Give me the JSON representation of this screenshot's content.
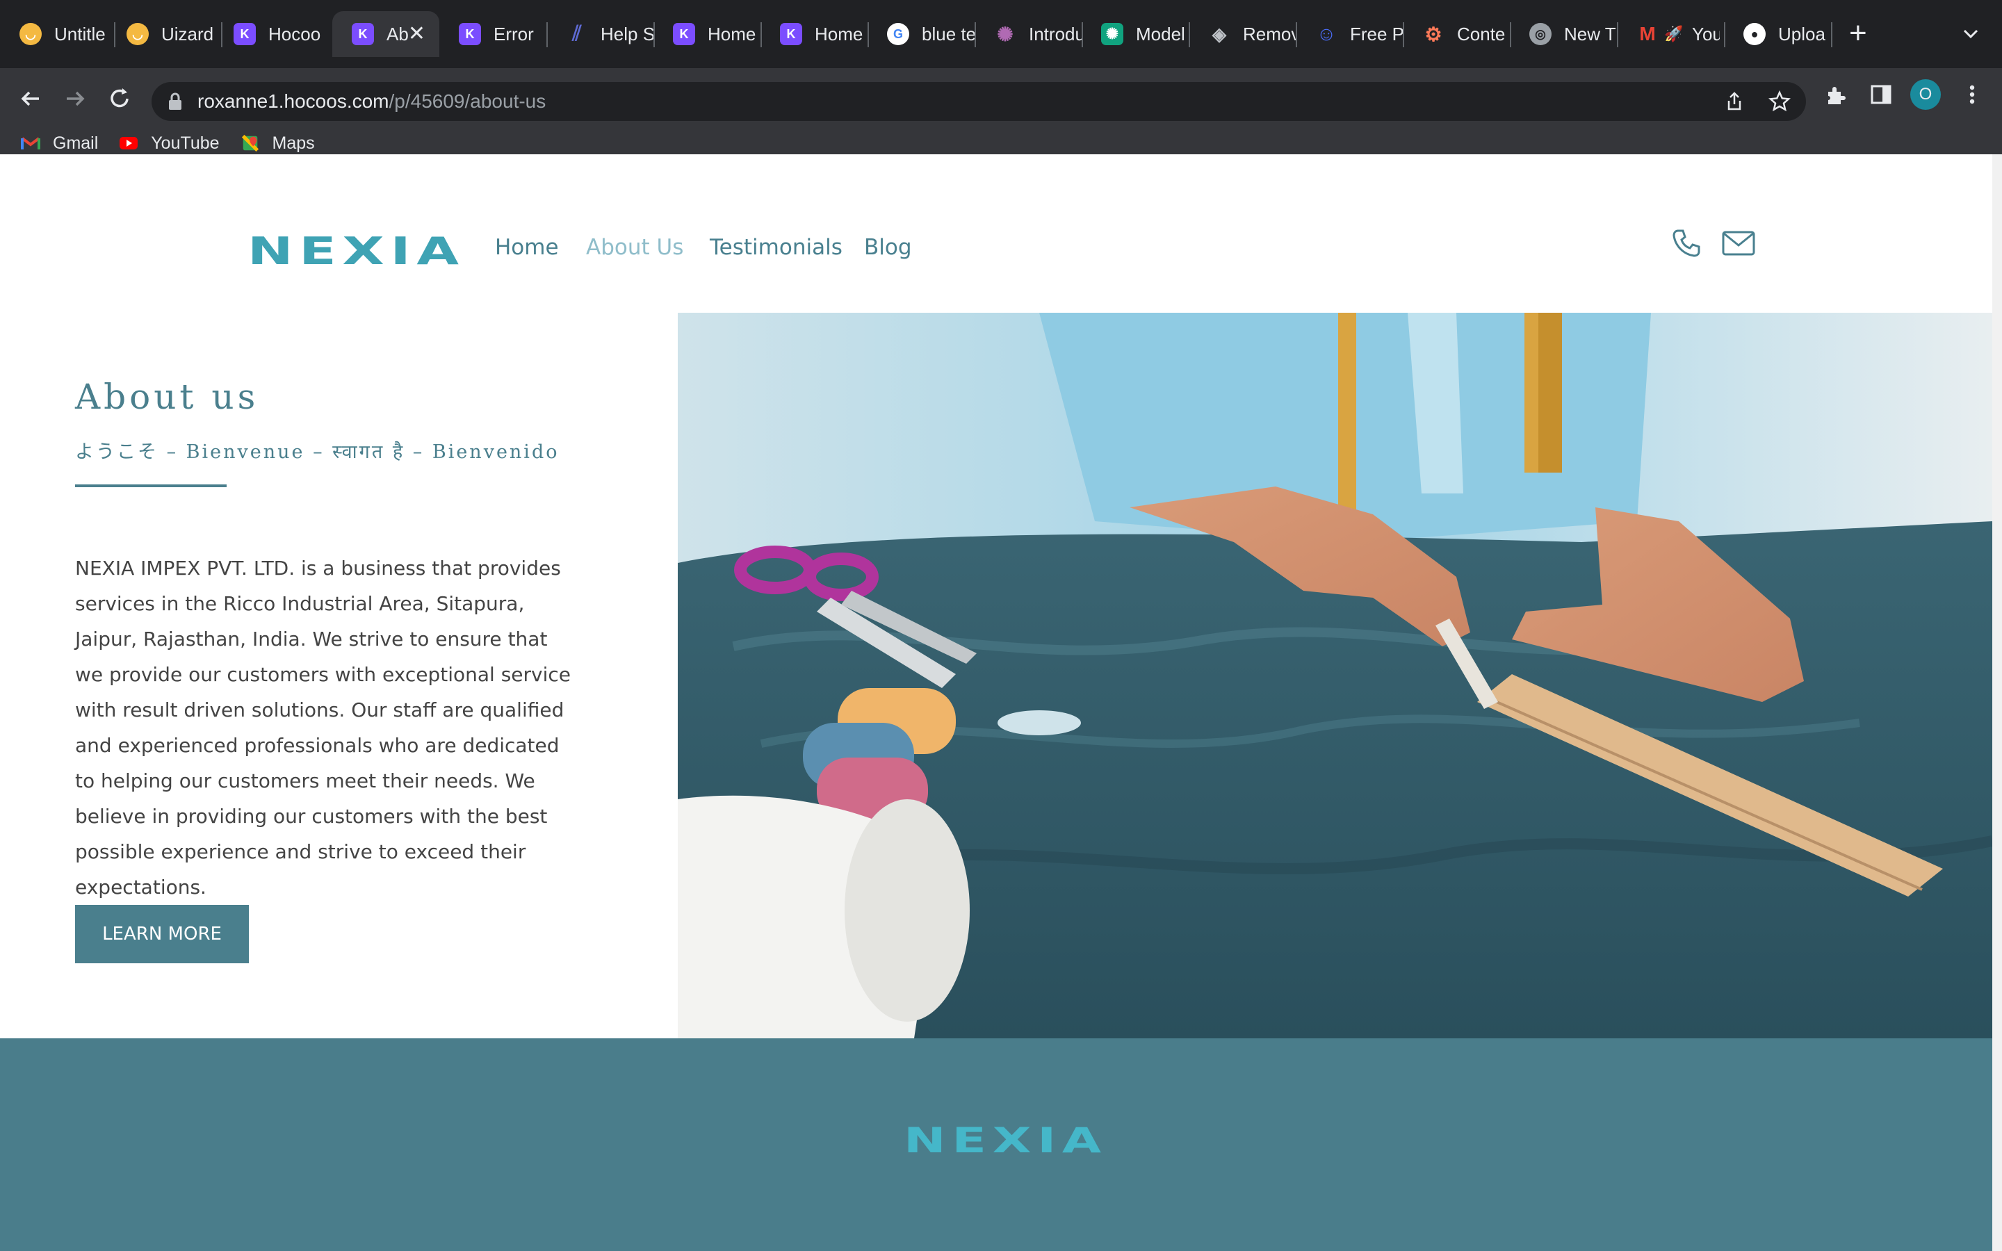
{
  "browser": {
    "tabs": [
      {
        "label": "Untitle",
        "icon": "uizard-icon",
        "color": "#f4b942"
      },
      {
        "label": "Uizard",
        "icon": "uizard-icon",
        "color": "#f4b942"
      },
      {
        "label": "Hocoo",
        "icon": "hocoos-icon",
        "color": "#7b4dff"
      },
      {
        "label": "Ab",
        "icon": "hocoos-icon",
        "color": "#7b4dff",
        "active": true
      },
      {
        "label": "Error",
        "icon": "hocoos-icon",
        "color": "#7b4dff"
      },
      {
        "label": "Help S",
        "icon": "linear-icon",
        "color": "#5e6ad2"
      },
      {
        "label": "Home",
        "icon": "hocoos-icon",
        "color": "#7b4dff"
      },
      {
        "label": "Home",
        "icon": "hocoos-icon",
        "color": "#7b4dff"
      },
      {
        "label": "blue te",
        "icon": "google-icon",
        "color": "#ffffff"
      },
      {
        "label": "Introdu",
        "icon": "openai-icon",
        "color": "#b06ab3"
      },
      {
        "label": "Model",
        "icon": "openai-icon",
        "color": "#10a37f"
      },
      {
        "label": "Remov",
        "icon": "layers-icon",
        "color": "#9aa0a6"
      },
      {
        "label": "Free P",
        "icon": "robot-icon",
        "color": "#4a6cf7"
      },
      {
        "label": "Conte",
        "icon": "hubspot-icon",
        "color": "#ff7a59"
      },
      {
        "label": "New T",
        "icon": "chrome-icon",
        "color": "#9aa0a6"
      },
      {
        "label": "You",
        "icon": "gmail-icon",
        "color": "#ea4335"
      },
      {
        "label": "Uploa",
        "icon": "github-icon",
        "color": "#ffffff"
      }
    ],
    "url_host": "roxanne1.hocoos.com",
    "url_path": "/p/45609/about-us",
    "profile_initial": "O",
    "bookmarks": [
      {
        "label": "Gmail",
        "icon": "gmail-icon"
      },
      {
        "label": "YouTube",
        "icon": "youtube-icon"
      },
      {
        "label": "Maps",
        "icon": "maps-icon"
      }
    ]
  },
  "site": {
    "logo": "NEXIA",
    "nav": [
      "Home",
      "About Us",
      "Testimonials",
      "Blog"
    ],
    "active_nav": "About Us",
    "about_title": "About us",
    "welcome_line": "ようこそ – Bienvenue – स्वागत है – Bienvenido",
    "body": "NEXIA IMPEX PVT. LTD. is a business that provides services in the Ricco Industrial Area, Sitapura, Jaipur, Rajasthan, India. We strive to ensure that we provide our customers with exceptional service with result driven solutions. Our staff are qualified and experienced professionals who are dedicated to helping our customers meet their needs. We believe in providing our customers with the best possible experience and strive to exceed their expectations.",
    "cta": "LEARN MORE",
    "footer_logo": "NEXIA",
    "accent_color": "#4a7f8d"
  }
}
